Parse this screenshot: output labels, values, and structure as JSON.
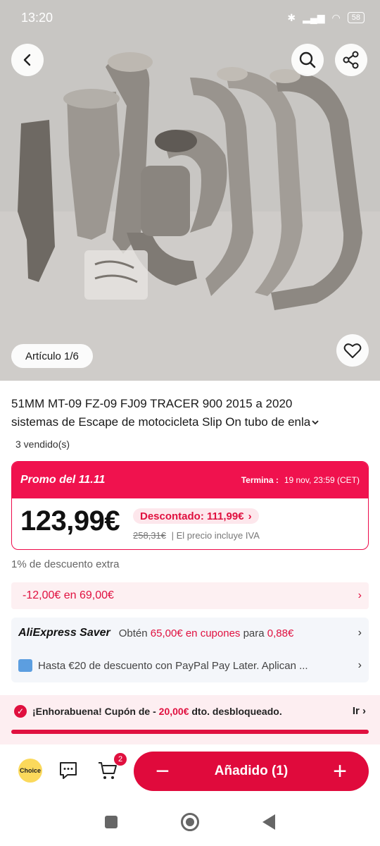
{
  "status_bar": {
    "time": "13:20",
    "battery": "58"
  },
  "gallery": {
    "counter": "Artículo 1/6"
  },
  "product": {
    "title_line1": "51MM MT-09 FZ-09 FJ09 TRACER 900 2015 a 2020",
    "title_line2": "sistemas de Escape de motocicleta Slip On tubo de enla",
    "sold": "3 vendido(s)"
  },
  "promo": {
    "label": "Promo del 11.11",
    "ends_label": "Termina :",
    "ends_value": "19 nov, 23:59 (CET)",
    "price": "123,99€",
    "discount": "Descontado: 111,99€",
    "old_price": "258,31€",
    "tax_note": "| El precio incluye IVA"
  },
  "extra_discount": "1% de descuento extra",
  "coupon": {
    "text": "-12,00€ en 69,00€"
  },
  "saver": {
    "brand": "AliExpress Saver",
    "prefix": "Obtén",
    "amount": "65,00€ en cupones",
    "middle": "para",
    "price": "0,88€"
  },
  "paypal": {
    "text": "Hasta €20 de descuento con PayPal Pay Later. Aplican ..."
  },
  "congrats": {
    "prefix": "¡Enhorabuena! Cupón de -",
    "amount": "20,00€",
    "suffix": "dto. desbloqueado.",
    "go": "Ir",
    "progress": 1.0
  },
  "bottom": {
    "choice": "Choice",
    "cart_count": "2",
    "added_label": "Añadido (1)"
  },
  "colors": {
    "accent": "#e00a3c",
    "promo_bg": "#f0124e",
    "soft_pink": "#fdeef1"
  }
}
